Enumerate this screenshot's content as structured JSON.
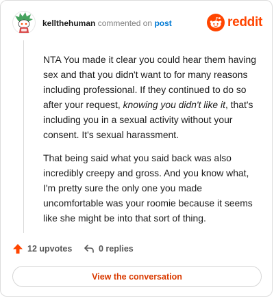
{
  "header": {
    "username": "kellthehuman",
    "action_text": "commented on",
    "post_link": "post",
    "brand": "reddit"
  },
  "comment": {
    "p1_a": "NTA You made it clear you could hear them having sex and that you didn't want to for many reasons including professional. If they continued to do so after your request, ",
    "p1_em": "knowing you didn't like it",
    "p1_b": ", that's including you in a sexual activity without your consent. It's sexual harassment.",
    "p2": "That being said what you said back was also incredibly creepy and gross. And you know what, I'm pretty sure the only one you made uncomfortable was your roomie because it seems like she might be into that sort of thing."
  },
  "actions": {
    "upvotes": "12 upvotes",
    "replies": "0 replies"
  },
  "cta": "View the conversation",
  "colors": {
    "brand": "#ff4500",
    "link": "#0079d3",
    "cta": "#d93a00",
    "avatar": "#46a35e"
  },
  "icons": {
    "avatar": "snoo-avatar-icon",
    "brand": "reddit-logo-icon",
    "upvote": "upvote-arrow-icon",
    "reply": "reply-arrow-icon"
  }
}
